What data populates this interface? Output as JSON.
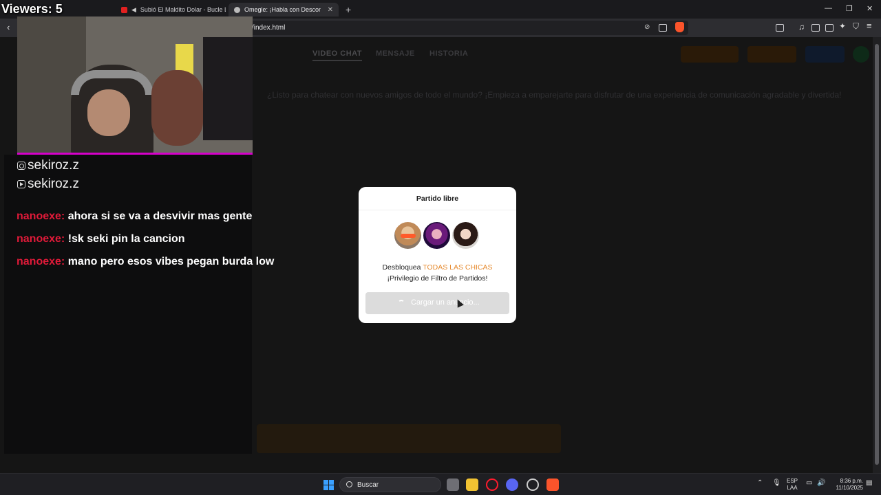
{
  "browser": {
    "tabs": [
      {
        "label": "Subió El Maldito Dolar - Bucle Lu"
      },
      {
        "label": "Omegle: ¡Habla con Desconocid"
      }
    ],
    "url": "/index.html"
  },
  "site": {
    "nav": [
      "VIDEO CHAT",
      "MENSAJE",
      "HISTORIA"
    ],
    "welcome": "¿Listo para chatear con nuevos amigos de todo el mundo? ¡Empieza a emparejarte para disfrutar de una experiencia de comunicación agradable y divertida!"
  },
  "modal": {
    "title": "Partido libre",
    "text_before": "Desbloquea ",
    "text_highlight": "TODAS LAS CHICAS",
    "text_after": " ¡Privilegio de Filtro de Partidos!",
    "button": "Cargar un anuncio...",
    "highlight_color": "#e68a2e"
  },
  "stream": {
    "viewers": "Viewers: 5",
    "socials": [
      {
        "icon": "instagram-icon",
        "handle": "sekiroz.z"
      },
      {
        "icon": "youtube-icon",
        "handle": "sekiroz.z"
      }
    ],
    "chat": [
      {
        "user": "nanoexe:",
        "message": "ahora si se va a desvivir mas gente"
      },
      {
        "user": "nanoexe:",
        "message": "!sk seki pin la cancion"
      },
      {
        "user": "nanoexe:",
        "message": "mano pero esos vibes pegan burda low"
      }
    ],
    "accent_color": "#d600ca",
    "username_color": "#e11a39"
  },
  "taskbar": {
    "search": "Buscar",
    "lang": "ESP",
    "lang_sub": "LAA",
    "time": "8:36 p.m.",
    "date": "11/10/2025"
  }
}
